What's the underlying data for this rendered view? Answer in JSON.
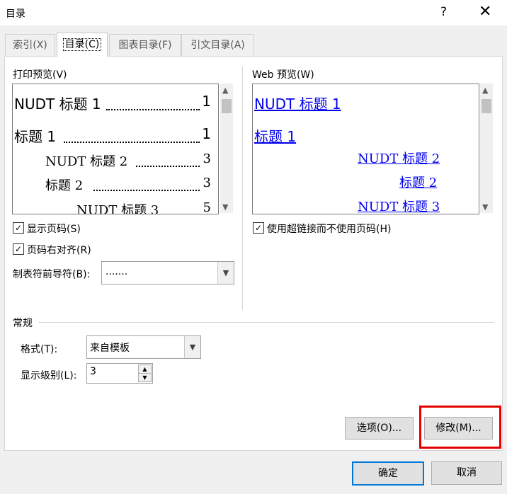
{
  "window": {
    "title": "目录",
    "help": "?",
    "close": "✕"
  },
  "tabs": [
    {
      "label": "索引(X)"
    },
    {
      "label": "目录(C)"
    },
    {
      "label": "图表目录(F)"
    },
    {
      "label": "引文目录(A)"
    }
  ],
  "print_preview": {
    "label": "打印预览(V)",
    "lines": [
      {
        "text": "NUDT 标题 1",
        "page": "1"
      },
      {
        "text": "标题  1",
        "page": "1"
      },
      {
        "text": "NUDT 标题 2",
        "page": "3"
      },
      {
        "text": "标题  2",
        "page": "3"
      },
      {
        "text": "NUDT 标题 3",
        "page": "5"
      }
    ],
    "show_page_numbers": {
      "label": "显示页码(S)",
      "checked": "✓"
    },
    "right_align": {
      "label": "页码右对齐(R)",
      "checked": "✓"
    },
    "tab_leader": {
      "label": "制表符前导符(B):",
      "value": "......."
    }
  },
  "web_preview": {
    "label": "Web 预览(W)",
    "links": [
      "NUDT 标题 1",
      "标题  1",
      "NUDT 标题 2",
      "标题  2",
      "NUDT 标题 3"
    ],
    "use_hyperlinks": {
      "label": "使用超链接而不使用页码(H)",
      "checked": "✓"
    }
  },
  "general": {
    "label": "常规",
    "format": {
      "label": "格式(T):",
      "value": "来自模板"
    },
    "levels": {
      "label": "显示级别(L):",
      "value": "3"
    }
  },
  "buttons": {
    "options": "选项(O)...",
    "modify": "修改(M)...",
    "ok": "确定",
    "cancel": "取消"
  },
  "icons": {
    "up": "▲",
    "down": "▼",
    "combo": "▼",
    "spin_up": "▲",
    "spin_down": "▼"
  },
  "colors": {
    "highlight": "#e60000",
    "link": "#0000ee",
    "default_button": "#0078d7"
  }
}
